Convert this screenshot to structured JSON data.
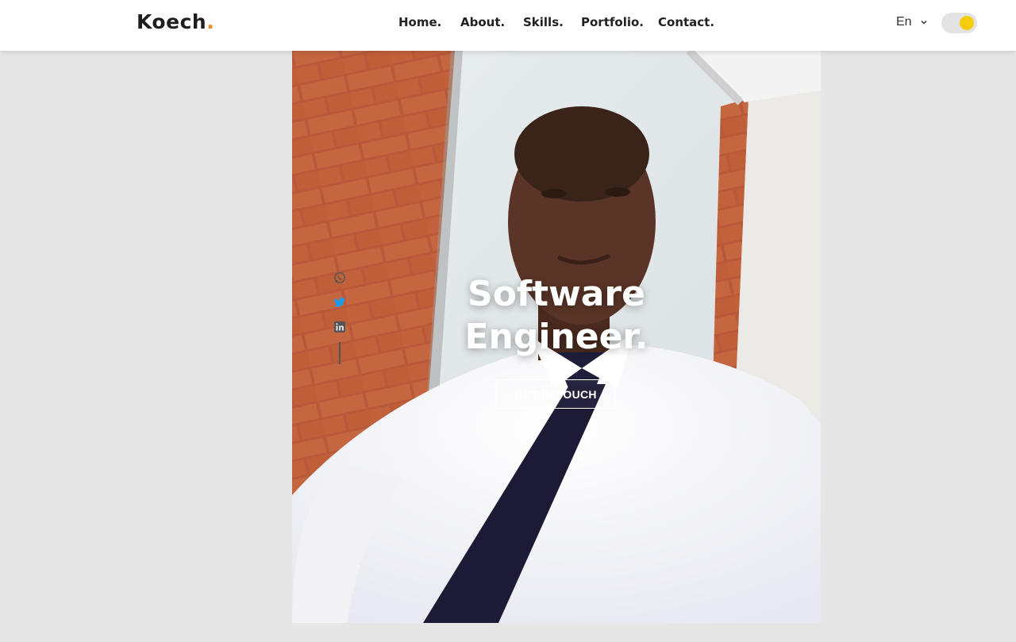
{
  "brand": {
    "name": "Koech",
    "dot": ".",
    "accent_color": "#f08a24"
  },
  "nav": {
    "links": [
      "Home.",
      "About.",
      "Skills.",
      "Portfolio.",
      "Contact."
    ]
  },
  "language": {
    "selected": "En",
    "icon": "chevron-down-icon"
  },
  "theme_toggle": {
    "knob_color": "#f5cd0c",
    "state": "on"
  },
  "hero": {
    "title_line1": "Software",
    "title_line2": "Engineer.",
    "cta_label": "GET IN TOUCH"
  },
  "social": {
    "icons": [
      "whatsapp-icon",
      "twitter-icon",
      "linkedin-icon"
    ]
  },
  "colors": {
    "background": "#e6e6e6",
    "nav_bg": "#ffffff",
    "text": "#222222"
  }
}
